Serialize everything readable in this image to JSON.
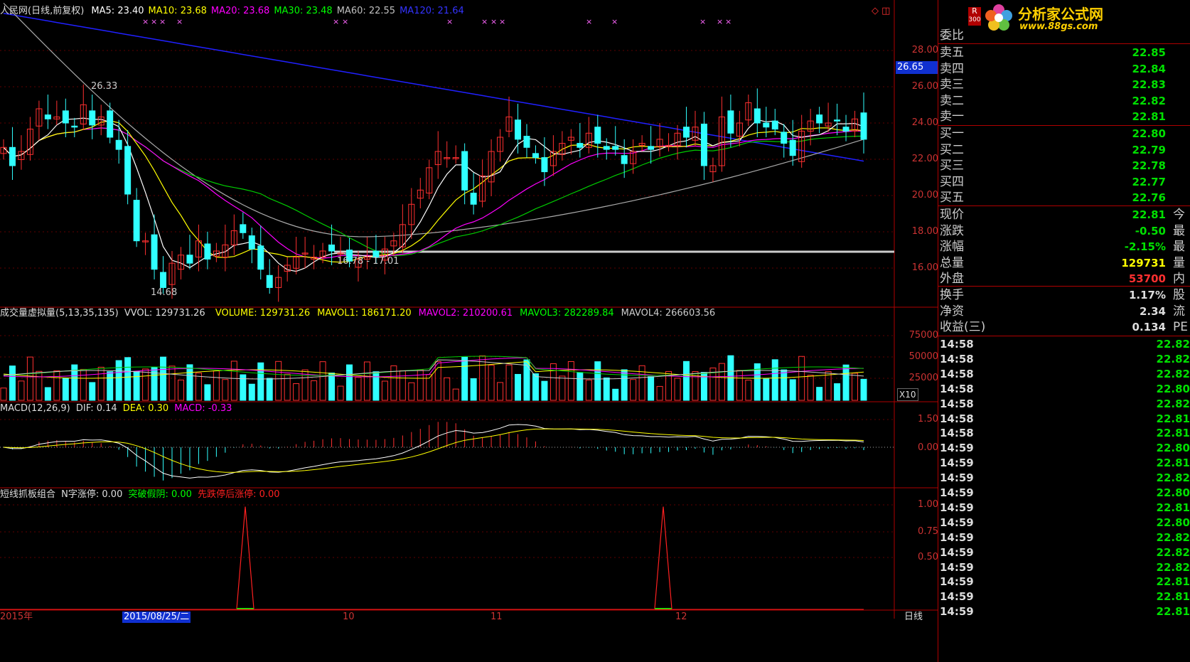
{
  "main": {
    "title": "人民网(日线,前复权)",
    "ma": [
      {
        "label": "MA5: 23.40",
        "color": "#ffffff"
      },
      {
        "label": "MA10: 23.68",
        "color": "#ffff00"
      },
      {
        "label": "MA20: 23.68",
        "color": "#ff00ff"
      },
      {
        "label": "MA30: 23.48",
        "color": "#00ff00"
      },
      {
        "label": "MA60: 22.55",
        "color": "#c0c0c0"
      },
      {
        "label": "MA120: 21.64",
        "color": "#3333ff"
      }
    ],
    "price_axis": [
      "28.00",
      "26.00",
      "24.00",
      "22.00",
      "20.00",
      "18.00",
      "16.00"
    ],
    "price_marker": "26.65",
    "annot_high": "26.33",
    "annot_low": "14.68",
    "annot_range": "16.78 - 17.01",
    "top_icons": "◇ ◫"
  },
  "volume": {
    "title": "成交量虚拟量(5,13,35,135)",
    "vvol": "VVOL: 129731.26",
    "items": [
      {
        "label": "VOLUME: 129731.26",
        "color": "#ffff00"
      },
      {
        "label": "MAVOL1: 186171.20",
        "color": "#ffff00"
      },
      {
        "label": "MAVOL2: 210200.61",
        "color": "#ff00ff"
      },
      {
        "label": "MAVOL3: 282289.84",
        "color": "#00ff00"
      },
      {
        "label": "MAVOL4: 266603.56",
        "color": "#cccccc"
      }
    ],
    "axis": [
      "75000",
      "50000",
      "25000"
    ],
    "unit": "X10"
  },
  "macd": {
    "title": "MACD(12,26,9)",
    "dif": "DIF: 0.14",
    "dea": "DEA: 0.30",
    "macd": "MACD: -0.33",
    "axis": [
      "1.50",
      "0.00"
    ]
  },
  "signal": {
    "title": "短线抓板组合",
    "n": "N字涨停: 0.00",
    "tp": "突破假阴: 0.00",
    "xd": "先跌停后涨停: 0.00",
    "axis": [
      "1.00",
      "0.75",
      "0.50"
    ]
  },
  "date_bar": {
    "labels": [
      "2015年",
      "2015/08/25/二",
      "10",
      "11",
      "12"
    ],
    "period": "日线"
  },
  "quote": {
    "badge": "R",
    "badge_sub": "300",
    "logo_text": "分析家公式网",
    "logo_url": "www.88gs.com",
    "wei_label": "委比",
    "sells": [
      {
        "label": "卖五",
        "val": "22.85"
      },
      {
        "label": "卖四",
        "val": "22.84"
      },
      {
        "label": "卖三",
        "val": "22.83"
      },
      {
        "label": "卖二",
        "val": "22.82"
      },
      {
        "label": "卖一",
        "val": "22.81"
      }
    ],
    "buys": [
      {
        "label": "买一",
        "val": "22.80"
      },
      {
        "label": "买二",
        "val": "22.79"
      },
      {
        "label": "买三",
        "val": "22.78"
      },
      {
        "label": "买四",
        "val": "22.77"
      },
      {
        "label": "买五",
        "val": "22.76"
      }
    ],
    "stats": [
      {
        "label": "现价",
        "val": "22.81",
        "color": "#00e000",
        "ext": "今"
      },
      {
        "label": "涨跌",
        "val": "-0.50",
        "color": "#00e000",
        "ext": "最"
      },
      {
        "label": "涨幅",
        "val": "-2.15%",
        "color": "#00e000",
        "ext": "最"
      },
      {
        "label": "总量",
        "val": "129731",
        "color": "#ffff00",
        "ext": "量"
      },
      {
        "label": "外盘",
        "val": "53700",
        "color": "#ff3030",
        "ext": "内"
      }
    ],
    "stats2": [
      {
        "label": "换手",
        "val": "1.17%",
        "color": "#dddddd",
        "ext": "股"
      },
      {
        "label": "净资",
        "val": "2.34",
        "color": "#dddddd",
        "ext": "流"
      },
      {
        "label": "收益(三)",
        "val": "0.134",
        "color": "#dddddd",
        "ext": "PE"
      }
    ],
    "ticks": [
      {
        "t": "14:58",
        "v": "22.82"
      },
      {
        "t": "14:58",
        "v": "22.82"
      },
      {
        "t": "14:58",
        "v": "22.82"
      },
      {
        "t": "14:58",
        "v": "22.80"
      },
      {
        "t": "14:58",
        "v": "22.82"
      },
      {
        "t": "14:58",
        "v": "22.81"
      },
      {
        "t": "14:58",
        "v": "22.81"
      },
      {
        "t": "14:59",
        "v": "22.80"
      },
      {
        "t": "14:59",
        "v": "22.81"
      },
      {
        "t": "14:59",
        "v": "22.82"
      },
      {
        "t": "14:59",
        "v": "22.80"
      },
      {
        "t": "14:59",
        "v": "22.81"
      },
      {
        "t": "14:59",
        "v": "22.80"
      },
      {
        "t": "14:59",
        "v": "22.82"
      },
      {
        "t": "14:59",
        "v": "22.82"
      },
      {
        "t": "14:59",
        "v": "22.82"
      },
      {
        "t": "14:59",
        "v": "22.81"
      },
      {
        "t": "14:59",
        "v": "22.81"
      },
      {
        "t": "14:59",
        "v": "22.81"
      }
    ]
  },
  "chart_data": {
    "type": "candlestick",
    "note_series": "daily candles approx. 2015-07 to 2015-12",
    "close": [
      22.4,
      21.5,
      22.2,
      23.3,
      24.3,
      23.8,
      23.9,
      23.6,
      23.4,
      24.5,
      23.5,
      23.9,
      22.9,
      22.3,
      20.1,
      17.8,
      17.8,
      16.4,
      15.5,
      16.7,
      17.1,
      16.7,
      17.8,
      16.9,
      17.3,
      17.6,
      18.3,
      18.2,
      17.4,
      16.4,
      15.5,
      16.0,
      16.6,
      17.0,
      17.2,
      17.0,
      17.3,
      17.3,
      17.2,
      16.8,
      16.9,
      17.0,
      17.0,
      17.4,
      17.8,
      18.6,
      19.6,
      20.3,
      21.4,
      22.2,
      21.9,
      21.9,
      20.3,
      19.6,
      21.0,
      22.2,
      22.9,
      23.9,
      22.8,
      22.4,
      21.9,
      21.2,
      22.2,
      22.6,
      22.9,
      22.4,
      23.1,
      22.6,
      22.3,
      22.3,
      21.6,
      22.2,
      22.6,
      22.3,
      22.8,
      22.5,
      23.1,
      22.9,
      23.4,
      21.5,
      21.5,
      23.9,
      23.1,
      23.6,
      24.6,
      23.6,
      23.4,
      23.3,
      22.6,
      22.0,
      23.2,
      23.7,
      23.6,
      23.6,
      23.7,
      23.2,
      23.8,
      22.8
    ],
    "ma_labels": [
      "MA5",
      "MA10",
      "MA20",
      "MA30",
      "MA60",
      "MA120"
    ],
    "price_range": [
      14.5,
      28.5
    ],
    "volume_axis": [
      25000,
      50000,
      75000
    ],
    "macd_range": [
      -0.9,
      1.7
    ],
    "signal_peaks": [
      0.97,
      0.97
    ]
  }
}
